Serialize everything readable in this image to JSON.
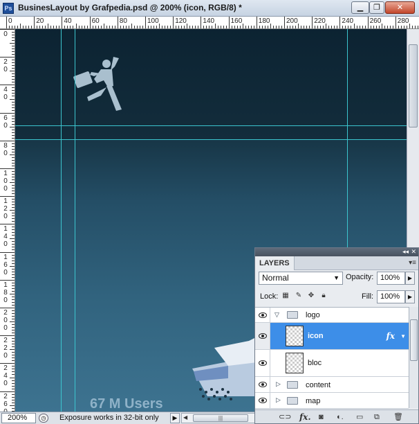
{
  "window": {
    "title": "BusinesLayout by Grafpedia.psd @ 200% (icon, RGB/8) *",
    "app_icon": "Ps",
    "minimize": "▁",
    "maximize": "❐",
    "close": "✕"
  },
  "ruler_top": [
    "0",
    "20",
    "40",
    "60",
    "80",
    "100",
    "120",
    "140",
    "160",
    "180",
    "200",
    "220",
    "240",
    "260",
    "280"
  ],
  "ruler_left": [
    "0",
    "20",
    "40",
    "60",
    "80",
    "100",
    "120",
    "140",
    "160",
    "180",
    "200",
    "220",
    "240",
    "260"
  ],
  "canvas": {
    "users_text": "67 M Users",
    "icon": "running-businessman-icon"
  },
  "statusbar": {
    "zoom": "200%",
    "message": "Exposure works in 32-bit only",
    "arrow": "▶"
  },
  "layers_panel": {
    "tab": "LAYERS",
    "blend_mode": "Normal",
    "opacity_label": "Opacity:",
    "opacity_value": "100%",
    "lock_label": "Lock:",
    "fill_label": "Fill:",
    "fill_value": "100%",
    "layers": [
      {
        "name": "logo",
        "type": "group",
        "expanded": true
      },
      {
        "name": "icon",
        "type": "layer",
        "selected": true,
        "fx": "fx"
      },
      {
        "name": "bloc",
        "type": "layer"
      },
      {
        "name": "content",
        "type": "group",
        "expanded": false
      },
      {
        "name": "map",
        "type": "group",
        "expanded": false
      }
    ]
  },
  "colors": {
    "guide": "#3cc6cf",
    "selection": "#3d8ee8",
    "canvas_dark": "#0f2836",
    "canvas_light": "#3d7390"
  }
}
